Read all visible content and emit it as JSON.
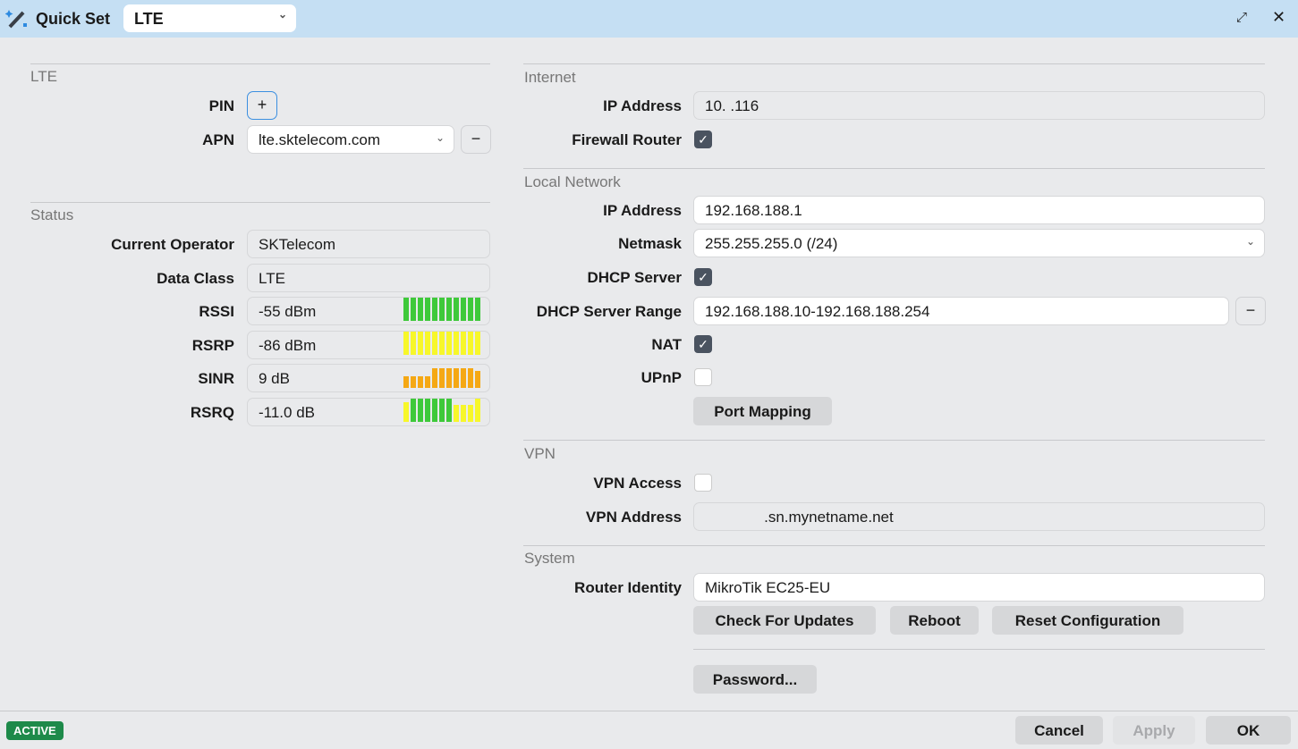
{
  "titlebar": {
    "title": "Quick Set",
    "mode": "LTE"
  },
  "lte": {
    "section": "LTE",
    "pin_label": "PIN",
    "apn_label": "APN",
    "apn_value": "lte.sktelecom.com"
  },
  "status": {
    "section": "Status",
    "rows": [
      {
        "label": "Current Operator",
        "value": "SKTelecom"
      },
      {
        "label": "Data Class",
        "value": "LTE"
      },
      {
        "label": "RSSI",
        "value": "-55 dBm",
        "bars": [
          "#3ec93a",
          "#3ec93a",
          "#3ec93a",
          "#3ec93a",
          "#3ec93a",
          "#3ec93a",
          "#3ec93a",
          "#3ec93a",
          "#3ec93a",
          "#3ec93a",
          "#3ec93a"
        ],
        "heights": [
          1,
          1,
          1,
          1,
          1,
          1,
          1,
          1,
          1,
          1,
          1
        ]
      },
      {
        "label": "RSRP",
        "value": "-86 dBm",
        "bars": [
          "#f7f72a",
          "#f7f72a",
          "#f7f72a",
          "#f7f72a",
          "#f7f72a",
          "#f7f72a",
          "#f7f72a",
          "#f7f72a",
          "#f7f72a",
          "#f7f72a",
          "#f7f72a"
        ],
        "heights": [
          1,
          1,
          1,
          1,
          1,
          1,
          1,
          1,
          1,
          1,
          1
        ]
      },
      {
        "label": "SINR",
        "value": "9 dB",
        "bars": [
          "#f5a814",
          "#f5a814",
          "#f5a814",
          "#f5a814",
          "#f5a814",
          "#f5a814",
          "#f5a814",
          "#f5a814",
          "#f5a814",
          "#f5a814",
          "#f5a814"
        ],
        "heights": [
          0.5,
          0.5,
          0.5,
          0.5,
          0.85,
          0.85,
          0.85,
          0.85,
          0.85,
          0.85,
          0.75
        ]
      },
      {
        "label": "RSRQ",
        "value": "-11.0 dB",
        "bars": [
          "#f7f72a",
          "#3ec93a",
          "#3ec93a",
          "#3ec93a",
          "#3ec93a",
          "#3ec93a",
          "#3ec93a",
          "#f7f72a",
          "#f7f72a",
          "#f7f72a",
          "#f7f72a"
        ],
        "heights": [
          0.85,
          1,
          1,
          1,
          1,
          1,
          1,
          0.75,
          0.75,
          0.75,
          1
        ]
      }
    ]
  },
  "internet": {
    "section": "Internet",
    "ip_label": "IP Address",
    "ip_value": "10.            .116",
    "firewall_label": "Firewall Router"
  },
  "local": {
    "section": "Local Network",
    "ip_label": "IP Address",
    "ip_value": "192.168.188.1",
    "netmask_label": "Netmask",
    "netmask_value": "255.255.255.0 (/24)",
    "dhcp_label": "DHCP Server",
    "range_label": "DHCP Server Range",
    "range_value": "192.168.188.10-192.168.188.254",
    "nat_label": "NAT",
    "upnp_label": "UPnP",
    "port_mapping": "Port Mapping"
  },
  "vpn": {
    "section": "VPN",
    "access_label": "VPN Access",
    "address_label": "VPN Address",
    "address_value": "              .sn.mynetname.net"
  },
  "system": {
    "section": "System",
    "identity_label": "Router Identity",
    "identity_value": "MikroTik EC25-EU",
    "check_updates": "Check For Updates",
    "reboot": "Reboot",
    "reset": "Reset Configuration",
    "password": "Password..."
  },
  "footer": {
    "status": "ACTIVE",
    "cancel": "Cancel",
    "apply": "Apply",
    "ok": "OK"
  }
}
